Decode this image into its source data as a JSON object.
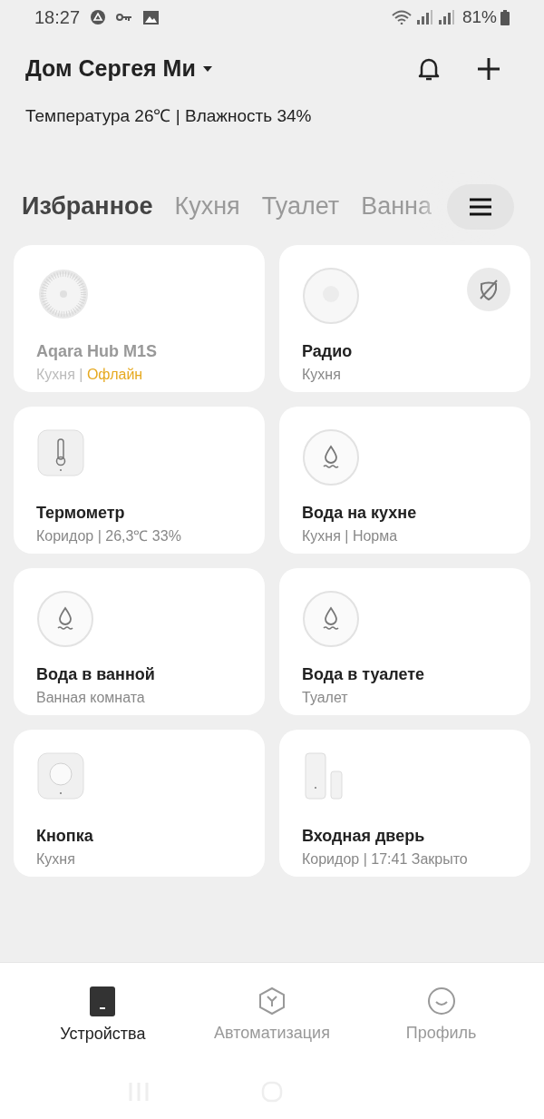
{
  "status_bar": {
    "time": "18:27",
    "battery": "81%"
  },
  "header": {
    "home": "Дом Сергея Ми",
    "climate": "Температура 26℃ | Влажность 34%"
  },
  "tabs": [
    {
      "label": "Избранное",
      "selected": true
    },
    {
      "label": "Кухня",
      "selected": false
    },
    {
      "label": "Туалет",
      "selected": false
    },
    {
      "label": "Ванна",
      "selected": false
    }
  ],
  "devices": [
    {
      "kind": "hub",
      "name": "Aqara Hub M1S",
      "room": "Кухня",
      "separator": "|",
      "status": "Офлайн",
      "offline": true,
      "unlinked": false
    },
    {
      "kind": "speaker",
      "name": "Радио",
      "room": "Кухня",
      "offline": false,
      "unlinked": true
    },
    {
      "kind": "thermometer",
      "name": "Термометр",
      "room": "Коридор",
      "separator": "|",
      "status": "26,3℃ 33%",
      "offline": false,
      "unlinked": false
    },
    {
      "kind": "water",
      "name": "Вода на кухне",
      "room": "Кухня",
      "separator": "|",
      "status": "Норма",
      "offline": false,
      "unlinked": false
    },
    {
      "kind": "water",
      "name": "Вода в ванной",
      "room": "Ванная комната",
      "offline": false,
      "unlinked": false
    },
    {
      "kind": "water",
      "name": "Вода в туалете",
      "room": "Туалет",
      "offline": false,
      "unlinked": false
    },
    {
      "kind": "button",
      "name": "Кнопка",
      "room": "Кухня",
      "offline": false,
      "unlinked": false
    },
    {
      "kind": "door",
      "name": "Входная дверь",
      "room": "Коридор",
      "separator": "|",
      "status": "17:41 Закрыто",
      "offline": false,
      "unlinked": false
    }
  ],
  "nav": [
    {
      "kind": "devices",
      "label": "Устройства",
      "selected": true
    },
    {
      "kind": "automation",
      "label": "Автоматизация",
      "selected": false
    },
    {
      "kind": "profile",
      "label": "Профиль",
      "selected": false
    }
  ]
}
